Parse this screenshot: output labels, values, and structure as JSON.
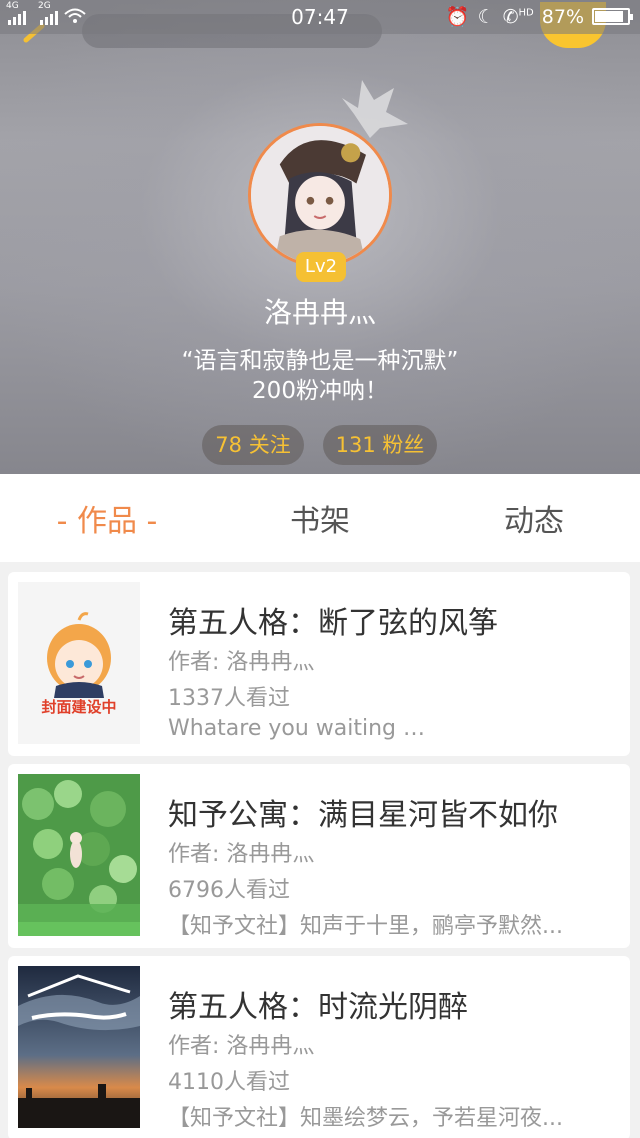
{
  "status_bar": {
    "network_1": "4G",
    "network_2": "2G",
    "time": "07:47",
    "hd_label": "HD",
    "battery": "87%",
    "battery_level": 0.87,
    "icons": [
      "alarm-icon",
      "moon-icon",
      "phone-icon",
      "battery-icon"
    ]
  },
  "profile": {
    "level": "Lv2",
    "name": "洛冉冉灬",
    "bio_line1": "“语言和寂静也是一种沉默”",
    "bio_line2": "200粉冲呐！",
    "following": "78 关注",
    "followers": "131 粉丝",
    "accent": "#f08a4b",
    "badge_color": "#f5c033"
  },
  "tabs": [
    {
      "label": "- 作品 -",
      "active": true
    },
    {
      "label": "书架",
      "active": false
    },
    {
      "label": "动态",
      "active": false
    }
  ],
  "works": [
    {
      "title": "第五人格：断了弦的风筝",
      "author": "作者: 洛冉冉灬",
      "views": "1337人看过",
      "desc": "Whatare you waiting …",
      "cover_text": "封面建设中"
    },
    {
      "title": "知予公寓：满目星河皆不如你",
      "author": "作者: 洛冉冉灬",
      "views": "6796人看过",
      "desc": "【知予文社】知声于十里，鹂亭予默然..."
    },
    {
      "title": "第五人格：时流光阴醉",
      "author": "作者: 洛冉冉灬",
      "views": "4110人看过",
      "desc": "【知予文社】知墨绘梦云，予若星河夜..."
    }
  ]
}
